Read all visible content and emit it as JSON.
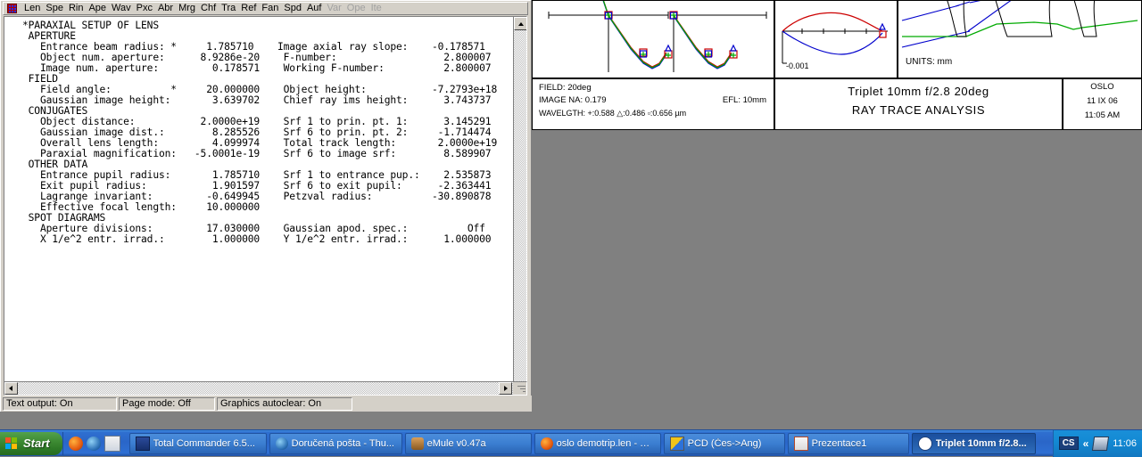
{
  "window": {
    "menu_items": [
      {
        "label": "Len",
        "enabled": true
      },
      {
        "label": "Spe",
        "enabled": true
      },
      {
        "label": "Rin",
        "enabled": true
      },
      {
        "label": "Ape",
        "enabled": true
      },
      {
        "label": "Wav",
        "enabled": true
      },
      {
        "label": "Pxc",
        "enabled": true
      },
      {
        "label": "Abr",
        "enabled": true
      },
      {
        "label": "Mrg",
        "enabled": true
      },
      {
        "label": "Chf",
        "enabled": true
      },
      {
        "label": "Tra",
        "enabled": true
      },
      {
        "label": "Ref",
        "enabled": true
      },
      {
        "label": "Fan",
        "enabled": true
      },
      {
        "label": "Spd",
        "enabled": true
      },
      {
        "label": "Auf",
        "enabled": true
      },
      {
        "label": "Var",
        "enabled": false
      },
      {
        "label": "Ope",
        "enabled": false
      },
      {
        "label": "Ite",
        "enabled": false
      }
    ],
    "report_text": "*PARAXIAL SETUP OF LENS\n APERTURE\n   Entrance beam radius: *     1.785710    Image axial ray slope:    -0.178571\n   Object num. aperture:      8.9286e-20    F-number:                  2.800007\n   Image num. aperture:         0.178571    Working F-number:          2.800007\n FIELD\n   Field angle:          *     20.000000    Object height:           -7.2793e+18\n   Gaussian image height:       3.639702    Chief ray ims height:      3.743737\n CONJUGATES\n   Object distance:           2.0000e+19    Srf 1 to prin. pt. 1:      3.145291\n   Gaussian image dist.:        8.285526    Srf 6 to prin. pt. 2:     -1.714474\n   Overall lens length:         4.099974    Total track length:       2.0000e+19\n   Paraxial magnification:   -5.0001e-19    Srf 6 to image srf:        8.589907\n OTHER DATA\n   Entrance pupil radius:       1.785710    Srf 1 to entrance pup.:    2.535873\n   Exit pupil radius:           1.901597    Srf 6 to exit pupil:      -2.363441\n   Lagrange invariant:         -0.649945    Petzval radius:          -30.890878\n   Effective focal length:     10.000000\n SPOT DIAGRAMS\n   Aperture divisions:         17.030000    Gaussian apod. spec.:          Off\n   X 1/e^2 entr. irrad.:        1.000000    Y 1/e^2 entr. irrad.:      1.000000"
  },
  "status_bar": {
    "cells": [
      "Text output: On",
      "Page mode: Off",
      "Graphics autoclear: On"
    ]
  },
  "graphics": {
    "ray_aberration_label": "-0.001",
    "units_label": "UNITS: mm",
    "info": {
      "field": "FIELD: 20deg",
      "image_na": "IMAGE NA: 0.179",
      "efl": "EFL: 10mm",
      "wavelength": "WAVELGTH: +:0.588  △:0.486  ▫:0.656 µm"
    },
    "title": {
      "line1": "Triplet   10mm  f/2.8   20deg",
      "line2": "RAY TRACE ANALYSIS"
    },
    "stamp": {
      "product": "OSLO",
      "date": "11 IX 06",
      "time": "11:05 AM"
    },
    "colors": {
      "wave_588": "#cc0000",
      "wave_486": "#0000cc",
      "wave_656": "#00aa00",
      "axis": "#000000"
    }
  },
  "chart_data": [
    {
      "type": "line",
      "name": "transverse-ray-aberration-left",
      "title": "",
      "xlabel": "",
      "ylabel": "",
      "series": [
        {
          "name": "0.588",
          "color": "#cc0000"
        },
        {
          "name": "0.486",
          "color": "#0000cc"
        },
        {
          "name": "0.656",
          "color": "#00aa00"
        }
      ]
    },
    {
      "type": "line",
      "name": "transverse-ray-aberration-right",
      "series": [
        {
          "name": "0.588",
          "color": "#cc0000"
        },
        {
          "name": "0.486",
          "color": "#0000cc"
        },
        {
          "name": "0.656",
          "color": "#00aa00"
        }
      ]
    },
    {
      "type": "line",
      "name": "optical-path-difference",
      "ylim": [
        -0.001,
        0.001
      ],
      "ytick_label": "-0.001",
      "series": [
        {
          "name": "0.588",
          "color": "#cc0000"
        },
        {
          "name": "0.486",
          "color": "#0000cc"
        }
      ]
    },
    {
      "type": "line",
      "name": "lens-layout-raytrace",
      "units": "mm",
      "series": [
        {
          "name": "on-axis-bundle",
          "color": "#0000cc"
        },
        {
          "name": "field-bundle",
          "color": "#00aa00"
        }
      ]
    }
  ],
  "taskbar": {
    "start_label": "Start",
    "quick_launch": [
      {
        "name": "firefox-icon"
      },
      {
        "name": "thunderbird-icon"
      },
      {
        "name": "notepad-icon"
      }
    ],
    "tasks": [
      {
        "label": "Total Commander 6.5...",
        "icon": "floppy-icon",
        "active": false
      },
      {
        "label": "Doručená pošta - Thu...",
        "icon": "thunderbird-icon",
        "active": false
      },
      {
        "label": "eMule v0.47a",
        "icon": "mule-icon",
        "active": false
      },
      {
        "label": "oslo demotrip.len - Vy...",
        "icon": "firefox-icon",
        "active": false
      },
      {
        "label": "PCD (Čes->Ang)",
        "icon": "pcd-icon",
        "active": false
      },
      {
        "label": "Prezentace1",
        "icon": "powerpoint-icon",
        "active": false
      },
      {
        "label": "Triplet  10mm f/2.8...",
        "icon": "oslo-icon",
        "active": true
      }
    ],
    "tray": {
      "language_indicator": "CS",
      "expand_label": "«",
      "network_icon": "network-icon",
      "clock": "11:06"
    }
  }
}
